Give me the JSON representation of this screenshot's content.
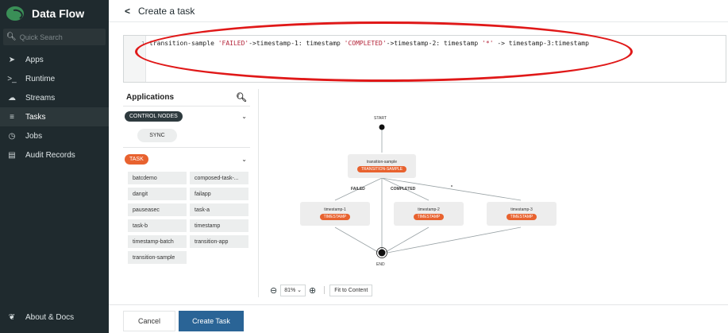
{
  "brand": {
    "title": "Data Flow"
  },
  "search": {
    "placeholder": "Quick Search"
  },
  "sidebar": {
    "items": [
      {
        "label": "Apps",
        "icon": "apps-icon",
        "glyph": "➤"
      },
      {
        "label": "Runtime",
        "icon": "terminal-icon",
        "glyph": ">_"
      },
      {
        "label": "Streams",
        "icon": "cloud-icon",
        "glyph": "☁"
      },
      {
        "label": "Tasks",
        "icon": "tasks-icon",
        "glyph": "≡"
      },
      {
        "label": "Jobs",
        "icon": "clock-icon",
        "glyph": "◷"
      },
      {
        "label": "Audit Records",
        "icon": "list-icon",
        "glyph": "▤"
      }
    ],
    "active": "Tasks",
    "about": {
      "label": "About & Docs",
      "icon": "leaf-icon"
    }
  },
  "header": {
    "title": "Create a task"
  },
  "editor": {
    "line_number": "1",
    "dsl": "transition-sample 'FAILED'->timestamp-1: timestamp 'COMPLETED'->timestamp-2: timestamp '*' -> timestamp-3:timestamp"
  },
  "applications": {
    "title": "Applications",
    "control_nodes": {
      "label": "CONTROL NODES",
      "items": [
        "SYNC"
      ]
    },
    "task": {
      "label": "TASK",
      "items": [
        "batcdemo",
        "composed-task-...",
        "dangit",
        "failapp",
        "pauseasec",
        "task-a",
        "task-b",
        "timestamp",
        "timestamp-batch",
        "transition-app",
        "transition-sample"
      ]
    }
  },
  "graph": {
    "start": "START",
    "end": "END",
    "root": {
      "name": "transition-sample",
      "badge": "TRANSITION-SAMPLE"
    },
    "transitions": [
      "FAILED",
      "COMPLETED",
      "*"
    ],
    "children": [
      {
        "name": "timestamp-1",
        "badge": "TIMESTAMP"
      },
      {
        "name": "timestamp-2",
        "badge": "TIMESTAMP"
      },
      {
        "name": "timestamp-3",
        "badge": "TIMESTAMP"
      }
    ]
  },
  "zoom": {
    "level": "81%",
    "fit_label": "Fit to Content"
  },
  "footer": {
    "cancel": "Cancel",
    "create": "Create Task"
  },
  "colors": {
    "sidebar": "#1f2a2e",
    "accent": "#e8622f",
    "primary": "#2a6496",
    "annotation": "#e01818"
  }
}
